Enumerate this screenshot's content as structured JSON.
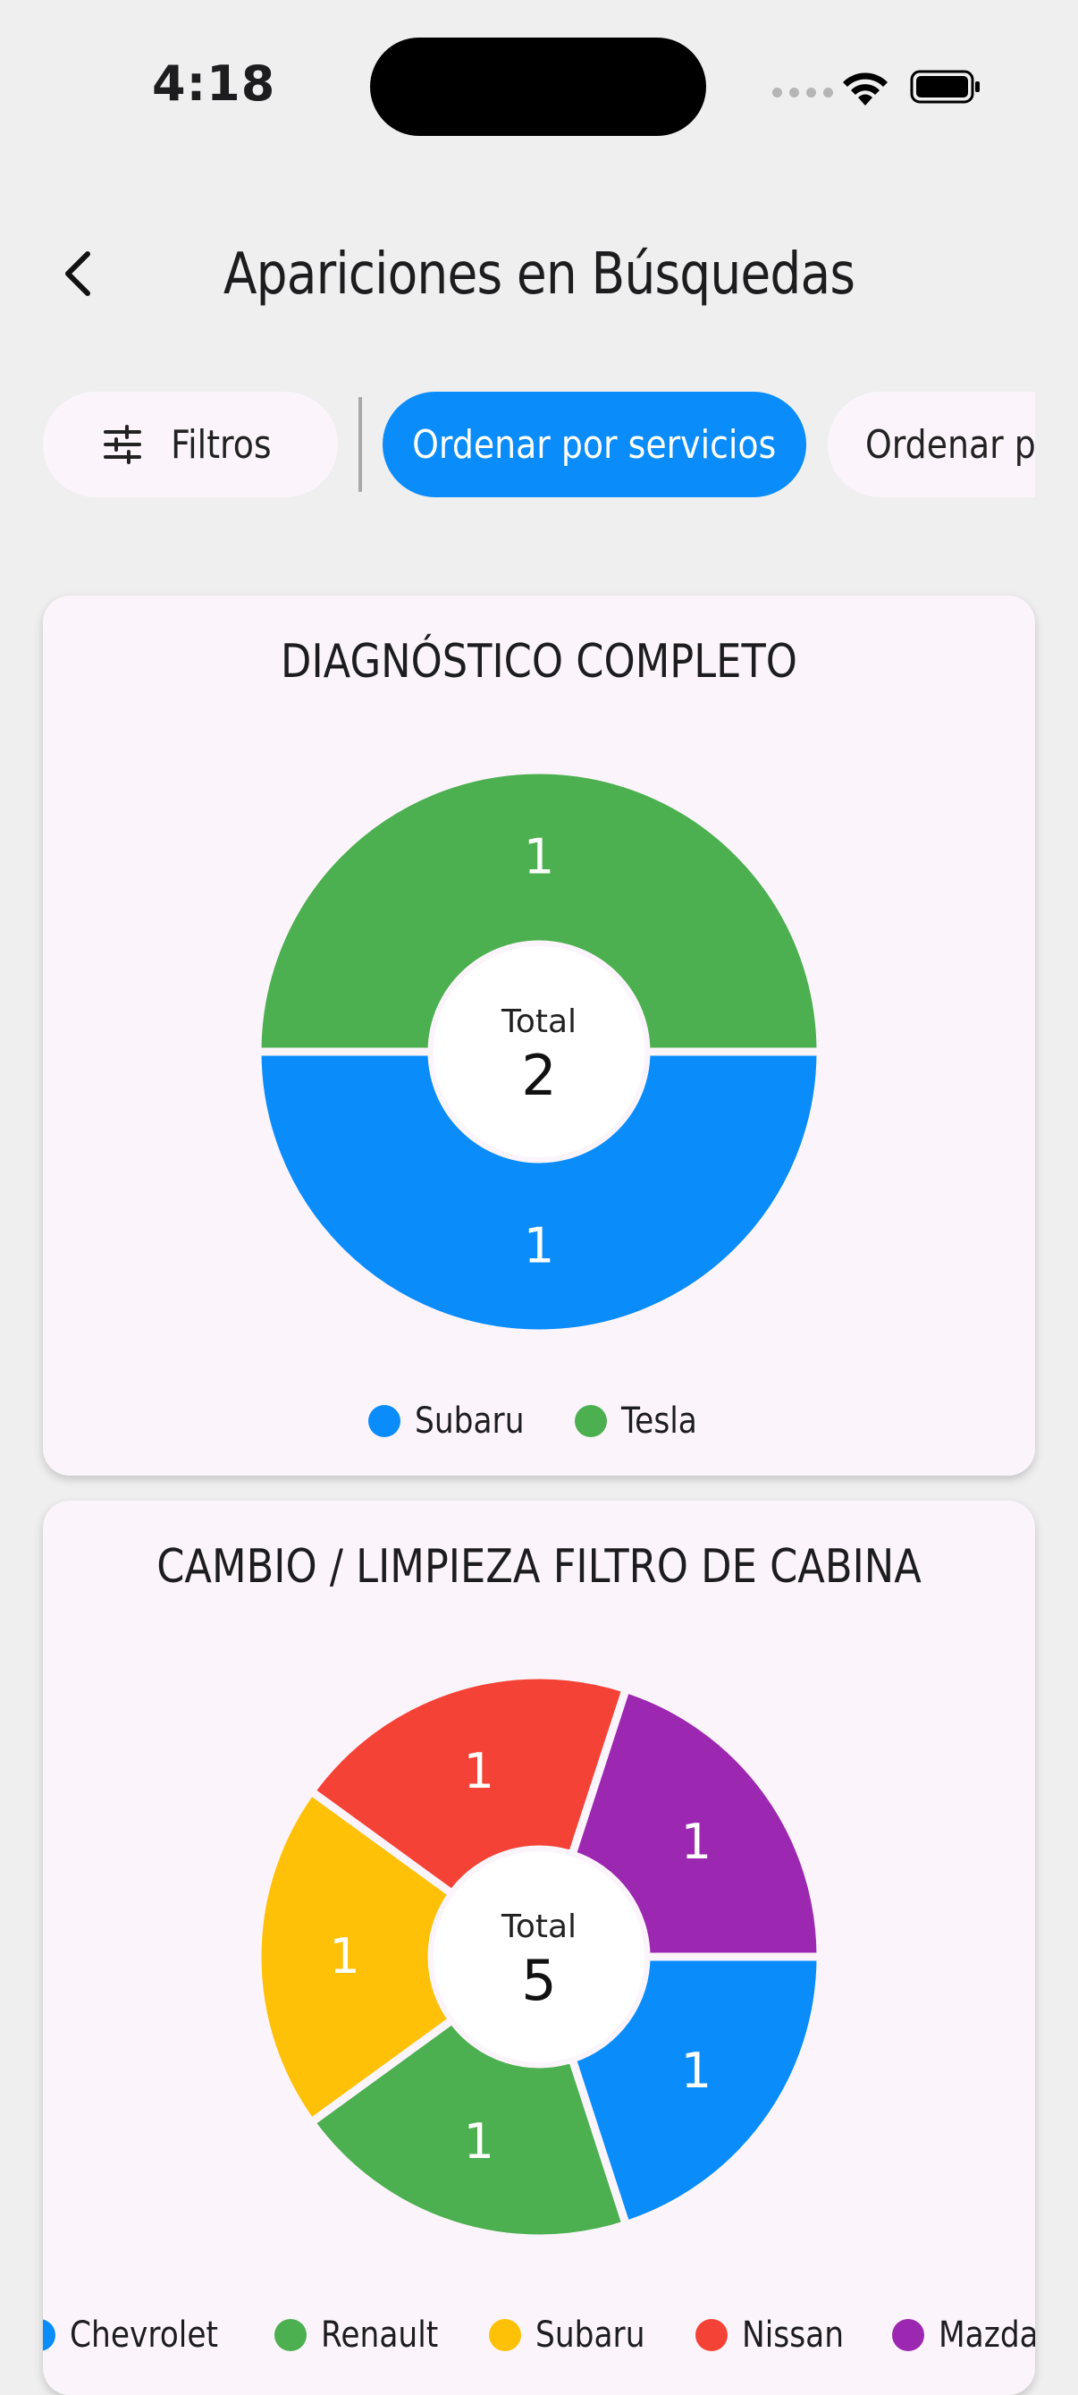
{
  "status": {
    "time": "4:18"
  },
  "header": {
    "title": "Apariciones en Búsquedas"
  },
  "chips": {
    "filters": "Filtros",
    "sort_services": "Ordenar por servicios",
    "sort_other": "Ordenar po"
  },
  "charts": [
    {
      "title": "DIAGNÓSTICO COMPLETO",
      "center_label": "Total",
      "center_value": "2",
      "chart_data": {
        "type": "pie",
        "categories": [
          "Subaru",
          "Tesla"
        ],
        "values": [
          1,
          1
        ],
        "colors": [
          "#0a8cfb",
          "#4caf50"
        ]
      }
    },
    {
      "title": "CAMBIO / LIMPIEZA FILTRO DE CABINA",
      "center_label": "Total",
      "center_value": "5",
      "chart_data": {
        "type": "pie",
        "categories": [
          "Chevrolet",
          "Renault",
          "Subaru",
          "Nissan",
          "Mazda"
        ],
        "values": [
          1,
          1,
          1,
          1,
          1
        ],
        "colors": [
          "#0a8cfb",
          "#4caf50",
          "#ffc107",
          "#f44336",
          "#9c27b0"
        ]
      }
    }
  ]
}
